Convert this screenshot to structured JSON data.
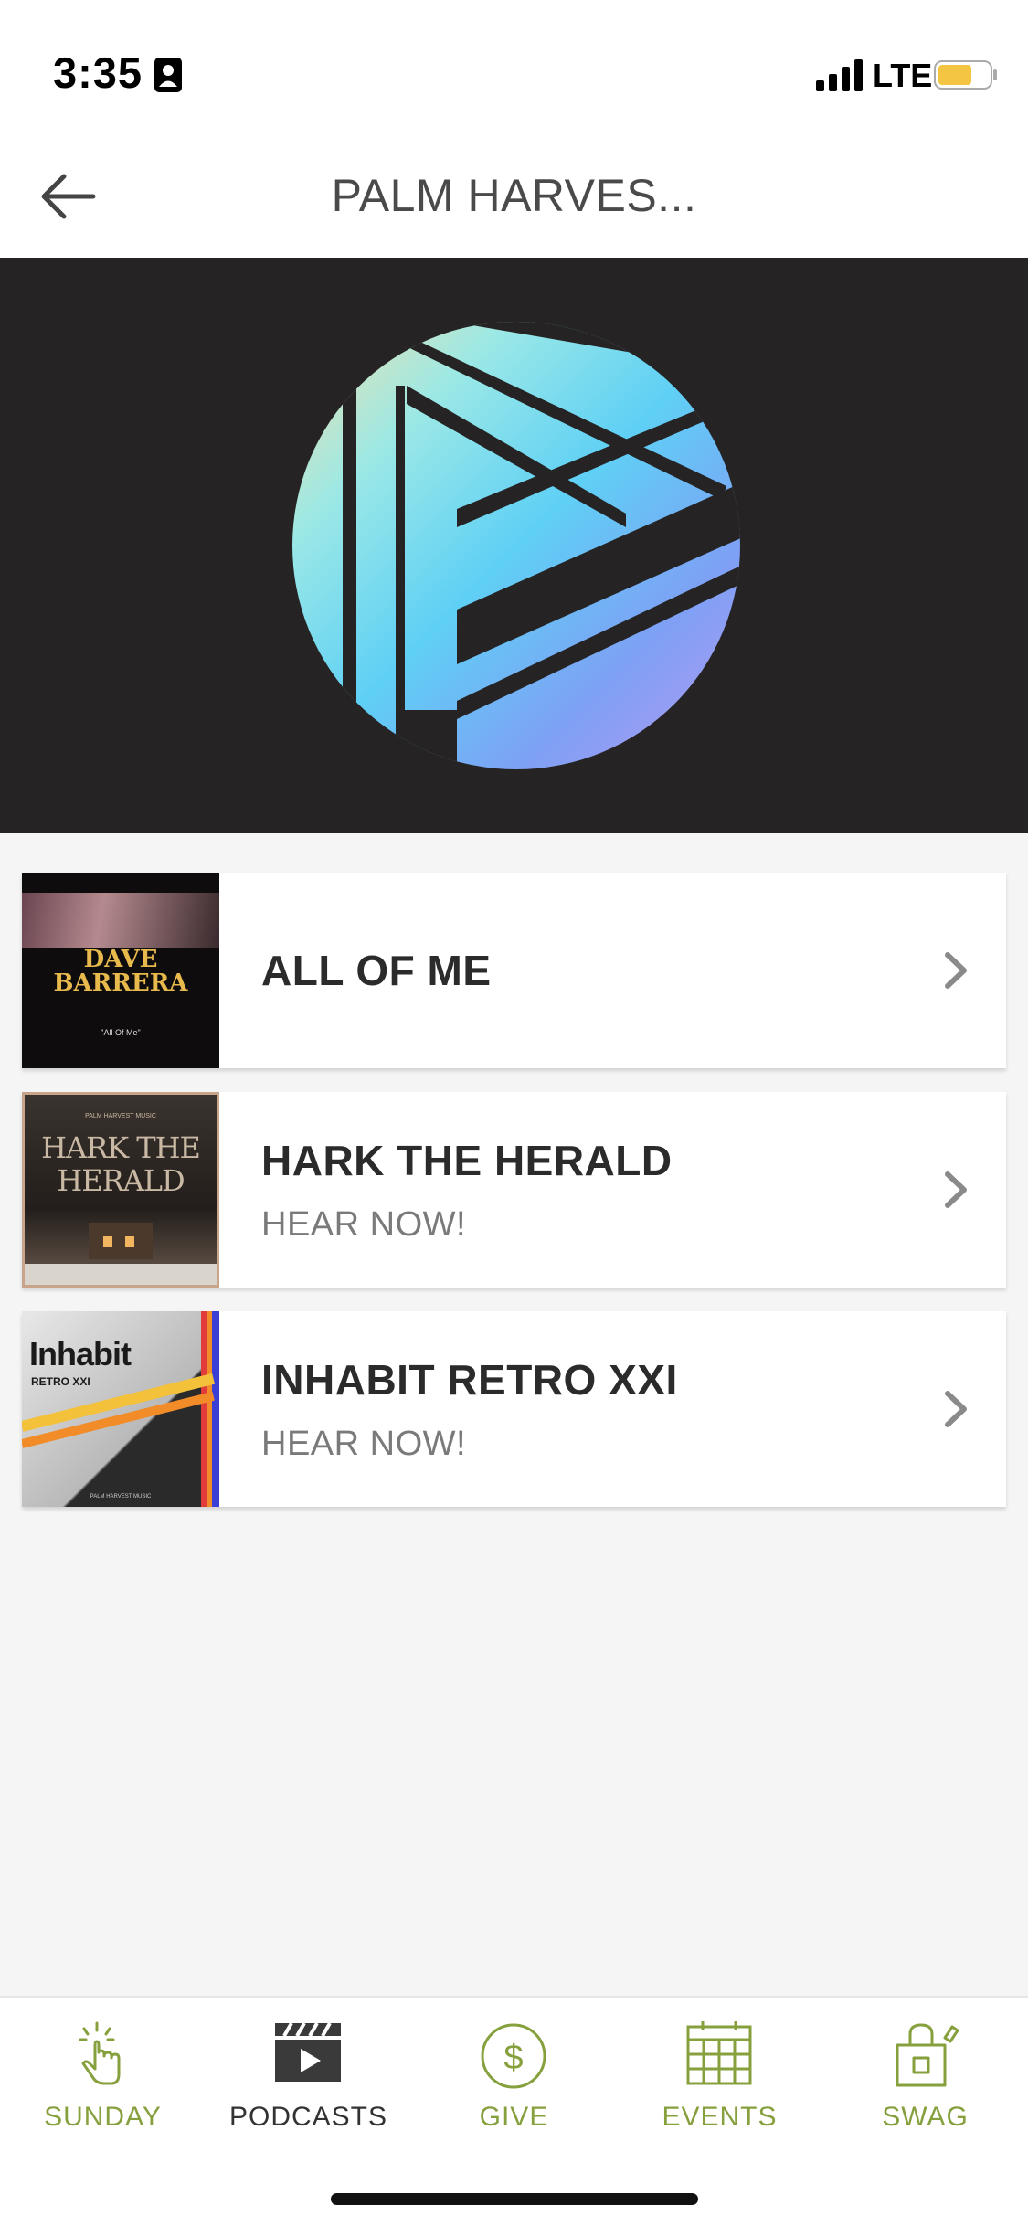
{
  "status_bar": {
    "time": "3:35",
    "network": "LTE",
    "battery_color": "#f4c542"
  },
  "header": {
    "title": "PALM HARVES...",
    "back_icon": "arrow-left-icon"
  },
  "hero": {
    "logo_icon": "play-triangle-logo"
  },
  "podcasts": [
    {
      "title": "ALL OF ME",
      "subtitle": "",
      "thumb_text": [
        "DAVE",
        "BARRERA"
      ],
      "thumb_caption": "\"All Of Me\""
    },
    {
      "title": "HARK THE HERALD",
      "subtitle": "HEAR NOW!",
      "thumb_text": [
        "HARK THE",
        "HERALD"
      ],
      "thumb_caption": "PALM HARVEST MUSIC"
    },
    {
      "title": "INHABIT RETRO XXI",
      "subtitle": "HEAR NOW!",
      "thumb_text": [
        "Inhabit",
        "RETRO XXI"
      ],
      "thumb_caption": "PALM HARVEST MUSIC"
    }
  ],
  "tabs": [
    {
      "label": "SUNDAY",
      "icon": "tap-hand-icon",
      "active": false
    },
    {
      "label": "PODCASTS",
      "icon": "clapperboard-icon",
      "active": true
    },
    {
      "label": "GIVE",
      "icon": "dollar-circle-icon",
      "active": false
    },
    {
      "label": "EVENTS",
      "icon": "calendar-icon",
      "active": false
    },
    {
      "label": "SWAG",
      "icon": "shopping-bag-icon",
      "active": false
    }
  ],
  "colors": {
    "accent": "#87a03e",
    "hero_bg": "#252323",
    "active_tab": "#333333"
  }
}
